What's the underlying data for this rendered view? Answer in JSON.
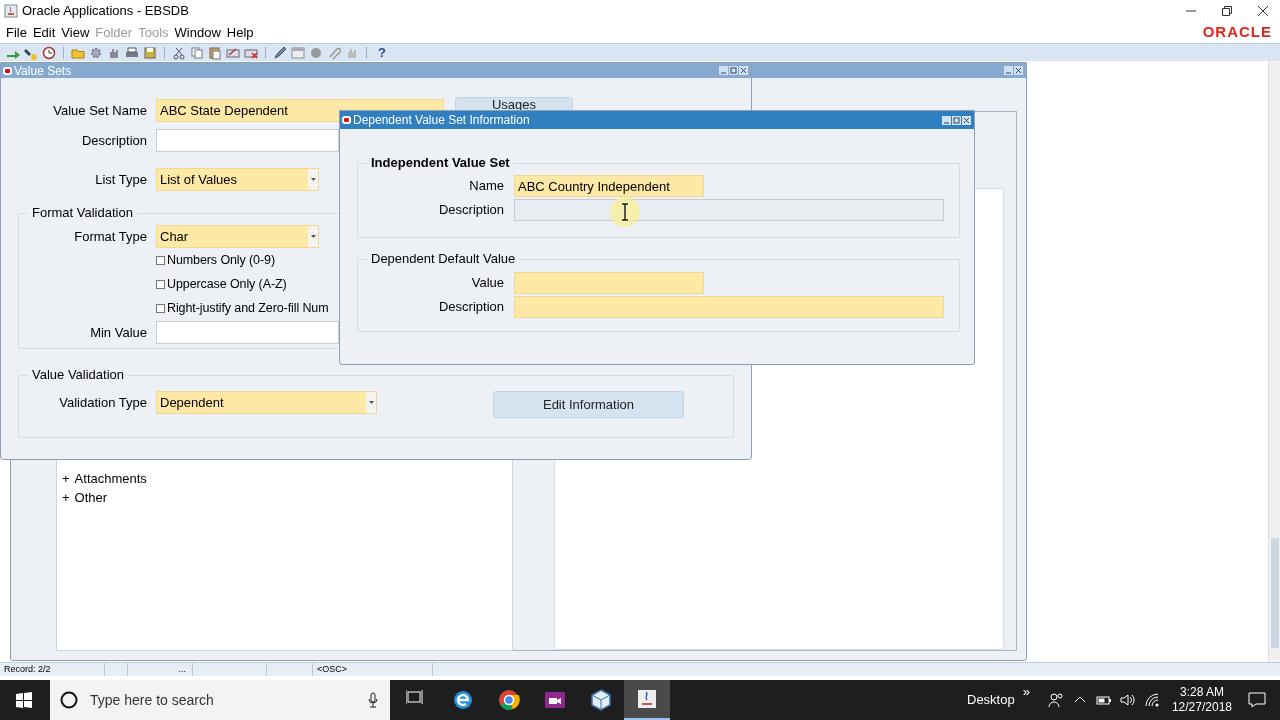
{
  "window": {
    "title": "Oracle Applications - EBSDB"
  },
  "menu": [
    {
      "label": "File",
      "disabled": false
    },
    {
      "label": "Edit",
      "disabled": false
    },
    {
      "label": "View",
      "disabled": false
    },
    {
      "label": "Folder",
      "disabled": true
    },
    {
      "label": "Tools",
      "disabled": true
    },
    {
      "label": "Window",
      "disabled": false
    },
    {
      "label": "Help",
      "disabled": false
    }
  ],
  "logo": "ORACLE",
  "toolbar": {
    "help": "?"
  },
  "tree_window": {
    "tree": [
      {
        "toggle": "+",
        "label": "Attachments"
      },
      {
        "toggle": "+",
        "label": "Other"
      }
    ]
  },
  "value_sets": {
    "title": "Value Sets",
    "name": {
      "label": "Value Set Name",
      "value": "ABC State Dependent",
      "required": true
    },
    "usages_button": "Usages",
    "description": {
      "label": "Description",
      "required": false
    },
    "list_type": {
      "label": "List Type",
      "value": "List of Values",
      "required": true,
      "dropdown": true
    },
    "format_validation": {
      "title": "Format Validation",
      "format_type": {
        "label": "Format Type",
        "value": "Char",
        "required": true,
        "dropdown": true
      },
      "options": [
        {
          "label": "Numbers Only (0-9)",
          "checked": false
        },
        {
          "label": "Uppercase Only (A-Z)",
          "checked": false
        },
        {
          "label": "Right-justify and Zero-fill Num",
          "checked": false
        }
      ],
      "min_value": {
        "label": "Min Value",
        "required": false
      }
    },
    "value_validation": {
      "title": "Value Validation",
      "validation_type": {
        "label": "Validation Type",
        "value": "Dependent",
        "required": true,
        "dropdown": true
      },
      "edit_button": "Edit Information"
    }
  },
  "dialog": {
    "title": "Dependent Value Set Information",
    "independent": {
      "title": "Independent Value Set",
      "name": {
        "label": "Name",
        "value": "ABC Country Independent",
        "required": true
      },
      "description": {
        "label": "Description",
        "readonly": true
      }
    },
    "dependent_default": {
      "title": "Dependent Default Value",
      "value": {
        "label": "Value",
        "required": true
      },
      "description": {
        "label": "Description",
        "required": true
      }
    }
  },
  "status_bar": {
    "record": "Record: 2/2",
    "dots": "...",
    "mode": "<OSC>"
  },
  "taskbar": {
    "search_placeholder": "Type here to search",
    "apps": [
      {
        "kind": "task-view",
        "selected": false
      },
      {
        "kind": "edge",
        "selected": false
      },
      {
        "kind": "chrome",
        "selected": false
      },
      {
        "kind": "video",
        "selected": false
      },
      {
        "kind": "box",
        "selected": false
      },
      {
        "kind": "java",
        "selected": true
      }
    ],
    "desktop_label": "Desktop",
    "overflow": "»",
    "time": "3:28 AM",
    "date": "12/27/2018"
  }
}
